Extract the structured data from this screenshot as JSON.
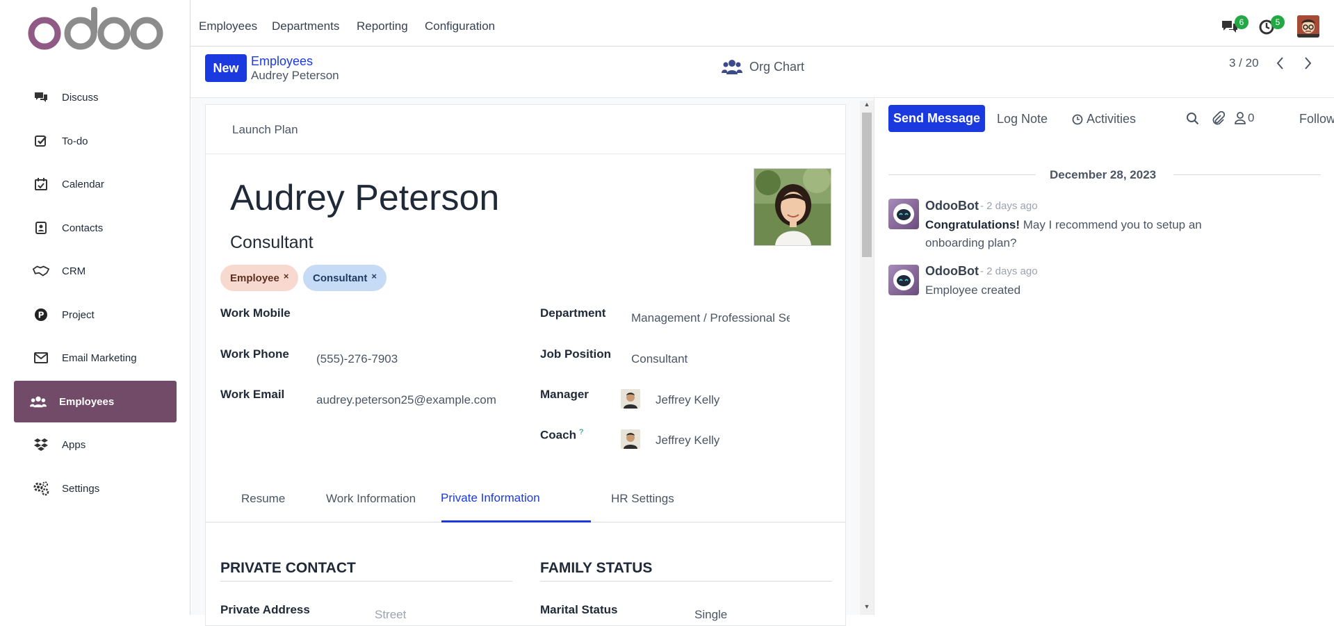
{
  "colors": {
    "brand": "#714b67",
    "primary_button": "#1a3ae0",
    "active_tab": "#1a3ae0",
    "employee_tag": "#f8d9cf",
    "consultant_tag": "#c6dcf6",
    "badge": "#22a845"
  },
  "sidebar": {
    "items": [
      {
        "label": "Discuss",
        "icon": "chat-bubbles-icon"
      },
      {
        "label": "To-do",
        "icon": "checkbox-icon"
      },
      {
        "label": "Calendar",
        "icon": "calendar-icon"
      },
      {
        "label": "Contacts",
        "icon": "contact-card-icon"
      },
      {
        "label": "CRM",
        "icon": "handshake-icon"
      },
      {
        "label": "Project",
        "icon": "project-p-icon"
      },
      {
        "label": "Email Marketing",
        "icon": "envelope-icon"
      },
      {
        "label": "Employees",
        "icon": "users-icon",
        "active": true
      },
      {
        "label": "Apps",
        "icon": "dropbox-icon"
      },
      {
        "label": "Settings",
        "icon": "gears-icon"
      }
    ]
  },
  "topbar": {
    "menus": [
      "Employees",
      "Departments",
      "Reporting",
      "Configuration"
    ],
    "messages_count": "6",
    "activities_count": "5"
  },
  "control": {
    "new_label": "New",
    "breadcrumb_parent": "Employees",
    "breadcrumb_current": "Audrey Peterson",
    "org_chart": "Org Chart",
    "pager": "3 / 20"
  },
  "form": {
    "launch_plan": "Launch Plan",
    "name": "Audrey Peterson",
    "job_title": "Consultant",
    "tags": [
      "Employee",
      "Consultant"
    ],
    "left_fields": [
      {
        "label": "Work Mobile",
        "value": ""
      },
      {
        "label": "Work Phone",
        "value": "(555)-276-7903"
      },
      {
        "label": "Work Email",
        "value": "audrey.peterson25@example.com"
      }
    ],
    "right_fields": {
      "department_label": "Department",
      "department_value": "Management / Professional Se",
      "job_label": "Job Position",
      "job_value": "Consultant",
      "manager_label": "Manager",
      "manager_value": "Jeffrey Kelly",
      "coach_label": "Coach",
      "coach_help": "?",
      "coach_value": "Jeffrey Kelly"
    },
    "tabs": [
      "Resume",
      "Work Information",
      "Private Information",
      "HR Settings"
    ],
    "active_tab": "Private Information",
    "private_contact_heading": "PRIVATE CONTACT",
    "family_status_heading": "FAMILY STATUS",
    "private_address_label": "Private Address",
    "private_address_placeholder": "Street",
    "marital_label": "Marital Status",
    "marital_value": "Single"
  },
  "chatter": {
    "send_message": "Send Message",
    "log_note": "Log Note",
    "activities": "Activities",
    "followers_count": "0",
    "follow": "Follow",
    "date": "December 28, 2023",
    "messages": [
      {
        "author": "OdooBot",
        "time": "- 2 days ago",
        "bold": "Congratulations!",
        "text": " May I recommend you to setup an onboarding plan?"
      },
      {
        "author": "OdooBot",
        "time": "- 2 days ago",
        "bold": "",
        "text": "Employee created"
      }
    ]
  }
}
